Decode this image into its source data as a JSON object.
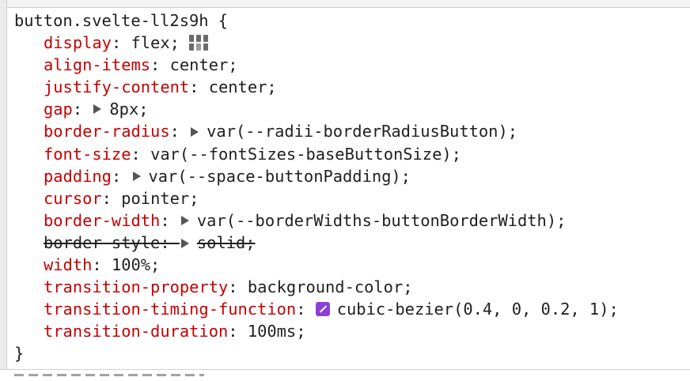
{
  "rule": {
    "selector": "button.svelte-ll2s9h {",
    "closing_brace": "}",
    "declarations": [
      {
        "prop": "display",
        "colon": ": ",
        "value": "flex;",
        "has_expander": false
      },
      {
        "prop": "align-items",
        "colon": ": ",
        "value": "center;",
        "has_expander": false
      },
      {
        "prop": "justify-content",
        "colon": ": ",
        "value": "center;",
        "has_expander": false
      },
      {
        "prop": "gap",
        "colon": ": ",
        "value": "8px;",
        "has_expander": true
      },
      {
        "prop": "border-radius",
        "colon": ": ",
        "value": "var(--radii-borderRadiusButton);",
        "has_expander": true
      },
      {
        "prop": "font-size",
        "colon": ": ",
        "value": "var(--fontSizes-baseButtonSize);",
        "has_expander": false
      },
      {
        "prop": "padding",
        "colon": ": ",
        "value": "var(--space-buttonPadding);",
        "has_expander": true
      },
      {
        "prop": "cursor",
        "colon": ": ",
        "value": "pointer;",
        "has_expander": false
      },
      {
        "prop": "border-width",
        "colon": ": ",
        "value": "var(--borderWidths-buttonBorderWidth);",
        "has_expander": true
      },
      {
        "prop": "border-style",
        "colon": ": ",
        "value": "solid;",
        "has_expander": true,
        "overridden": true
      },
      {
        "prop": "width",
        "colon": ": ",
        "value": "100%;",
        "has_expander": false
      },
      {
        "prop": "transition-property",
        "colon": ": ",
        "value": "background-color;",
        "has_expander": false
      },
      {
        "prop": "transition-timing-function",
        "colon": ": ",
        "value": "cubic-bezier(0.4, 0, 0.2, 1);",
        "has_expander": false
      },
      {
        "prop": "transition-duration",
        "colon": ": ",
        "value": "100ms;",
        "has_expander": false
      }
    ]
  },
  "icons": {
    "flex_editor": "flexbox-editor-icon",
    "bezier_editor": "cubic-bezier-editor-icon",
    "expander": "triangle-right-icon"
  },
  "colors": {
    "property": "#c80000",
    "value": "#1f1f1f",
    "bezier_swatch": "#8c3fd6",
    "divider": "#cfcfcf"
  }
}
